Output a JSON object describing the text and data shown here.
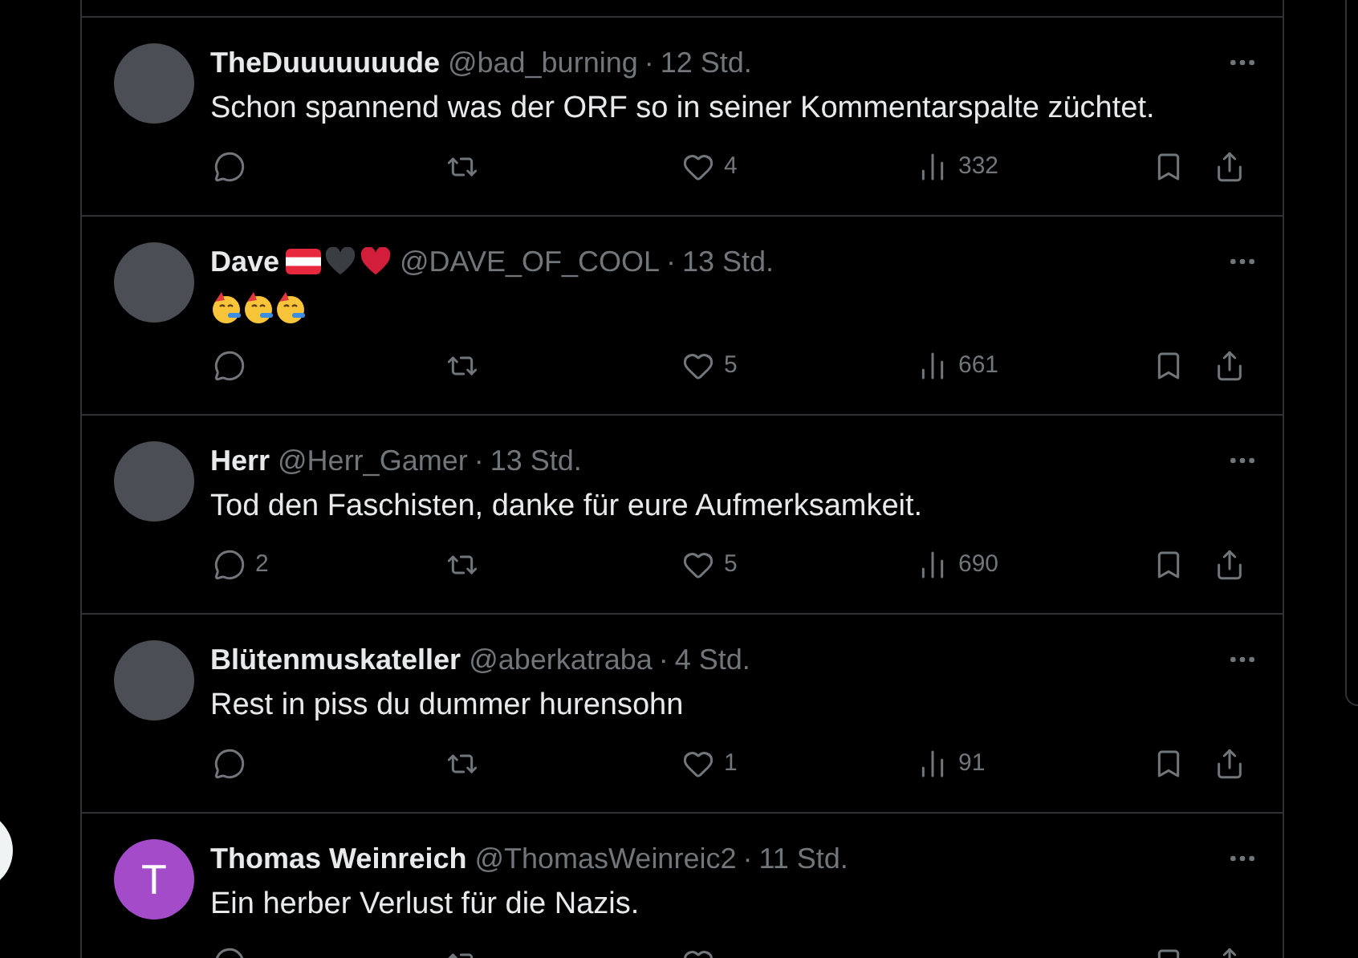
{
  "replies": [
    {
      "name": "TheDuuuuuuude",
      "handle": "@bad_burning",
      "separator": "·",
      "time": "12 Std.",
      "avatar": {
        "kind": "photo"
      },
      "body": "Schon spannend was der ORF so in seiner Kommentarspalte züchtet.",
      "counts": {
        "likes": "4",
        "views": "332"
      }
    },
    {
      "name": "Dave",
      "name_badges": [
        {
          "kind": "flag"
        },
        {
          "kind": "heart",
          "color": "#3a3d42"
        },
        {
          "kind": "heart",
          "color": "#d21d3b"
        }
      ],
      "handle": "@DAVE_OF_COOL",
      "separator": "·",
      "time": "13 Std.",
      "avatar": {
        "kind": "photo"
      },
      "body_emojis": [
        {
          "kind": "party"
        },
        {
          "kind": "party"
        },
        {
          "kind": "party"
        }
      ],
      "counts": {
        "likes": "5",
        "views": "661"
      }
    },
    {
      "name": "Herr",
      "handle": "@Herr_Gamer",
      "separator": "·",
      "time": "13 Std.",
      "avatar": {
        "kind": "photo"
      },
      "body": "Tod den Faschisten, danke für eure Aufmerksamkeit.",
      "counts": {
        "replies": "2",
        "likes": "5",
        "views": "690"
      }
    },
    {
      "name": "Blütenmuskateller",
      "handle": "@aberkatraba",
      "separator": "·",
      "time": "4 Std.",
      "avatar": {
        "kind": "photo"
      },
      "body": "Rest in piss du dummer hurensohn",
      "counts": {
        "likes": "1",
        "views": "91"
      }
    },
    {
      "name": "Thomas Weinreich",
      "handle": "@ThomasWeinreic2",
      "separator": "·",
      "time": "11 Std.",
      "avatar": {
        "kind": "letter",
        "letter": "T",
        "color": "#a34bc9"
      },
      "body": "Ein herber Verlust für die Nazis."
    }
  ]
}
